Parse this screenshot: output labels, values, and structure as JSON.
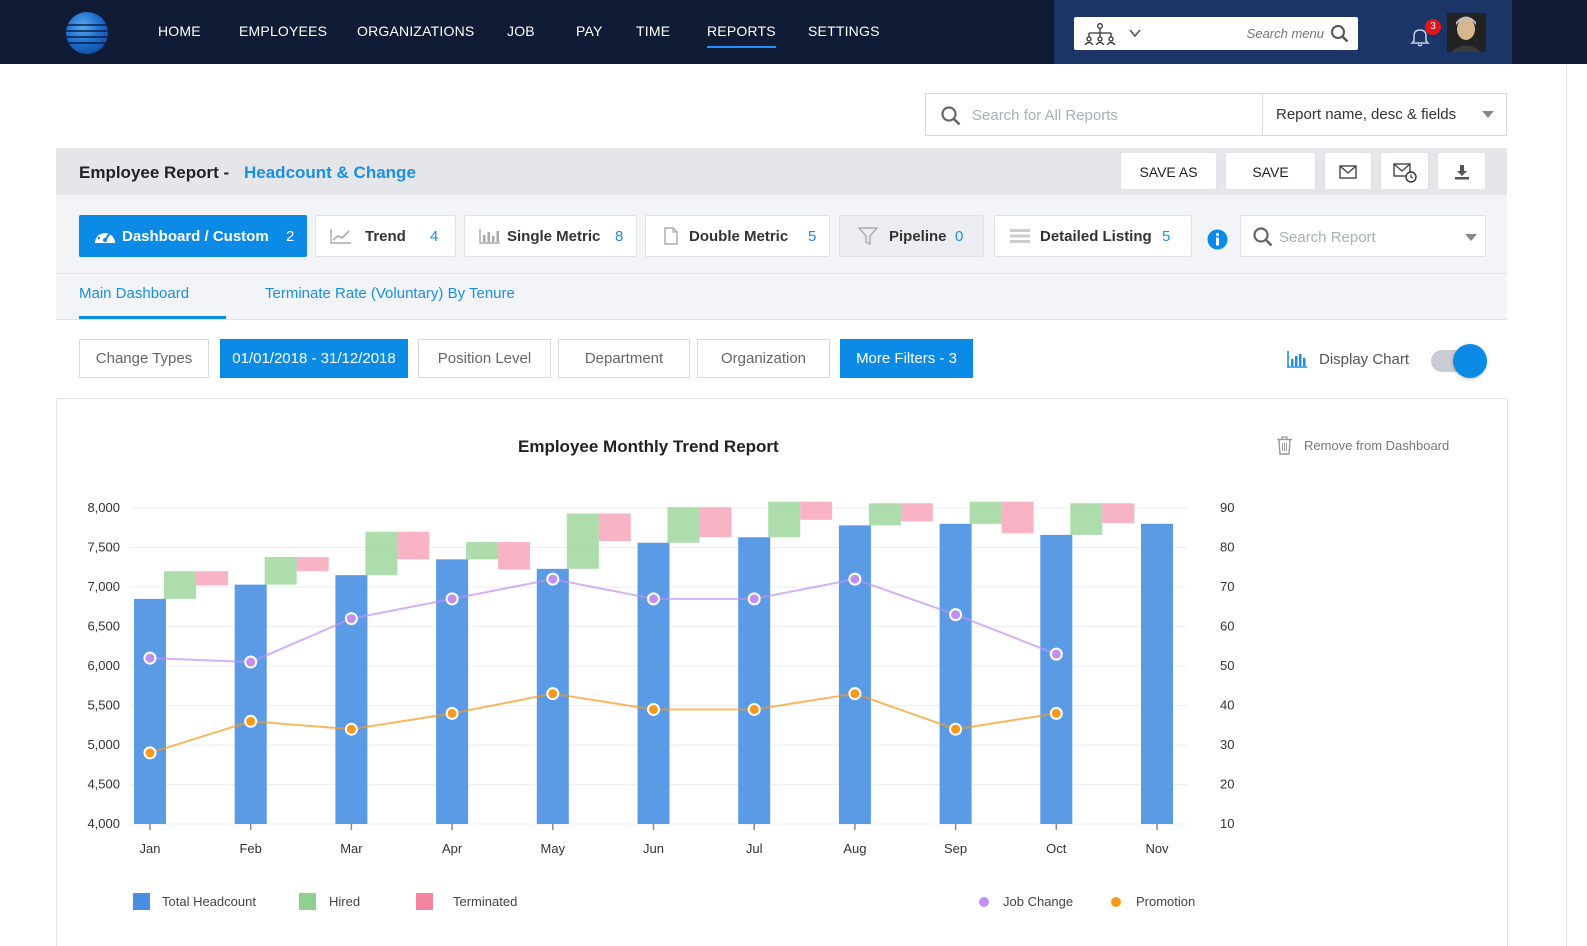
{
  "nav": {
    "items": [
      "HOME",
      "EMPLOYEES",
      "ORGANIZATIONS",
      "JOB",
      "PAY",
      "TIME",
      "REPORTS",
      "SETTINGS"
    ],
    "active": "REPORTS",
    "menu_search_placeholder": "Search menu",
    "notification_count": "3",
    "org_icon": "org-chart-icon"
  },
  "report_search": {
    "placeholder": "Search for All Reports",
    "scope": "Report name, desc & fields"
  },
  "report_header": {
    "title": "Employee Report -",
    "subtitle": "Headcount & Change",
    "save_as": "SAVE AS",
    "save": "SAVE"
  },
  "tabs": [
    {
      "label": "Dashboard / Custom",
      "count": "2",
      "icon": "dashboard-icon"
    },
    {
      "label": "Trend",
      "count": "4",
      "icon": "trend-icon"
    },
    {
      "label": "Single Metric",
      "count": "8",
      "icon": "bar-icon"
    },
    {
      "label": "Double Metric",
      "count": "5",
      "icon": "document-icon"
    },
    {
      "label": "Pipeline",
      "count": "0",
      "icon": "funnel-icon"
    },
    {
      "label": "Detailed Listing",
      "count": "5",
      "icon": "list-icon"
    }
  ],
  "search_report_placeholder": "Search Report",
  "subtabs": [
    "Main Dashboard",
    "Terminate Rate (Voluntary) By Tenure"
  ],
  "filters": {
    "change_types": "Change Types",
    "date_range": "01/01/2018 - 31/12/2018",
    "position_level": "Position Level",
    "department": "Department",
    "organization": "Organization",
    "more_filters": "More Filters - 3"
  },
  "display_chart": {
    "label": "Display Chart",
    "on": true
  },
  "remove_label": "Remove from Dashboard",
  "colors": {
    "accent": "#0b8be6",
    "headcount": "#5b9be5",
    "hired": "#9fd69f",
    "terminated": "#f7a7bb",
    "job_change": "#c290f5",
    "promotion": "#f59a1e"
  },
  "chart_data": {
    "type": "bar",
    "title": "Employee Monthly Trend Report",
    "categories": [
      "Jan",
      "Feb",
      "Mar",
      "Apr",
      "May",
      "Jun",
      "Jul",
      "Aug",
      "Sep",
      "Oct",
      "Nov"
    ],
    "y_left": {
      "ticks": [
        "4,000",
        "4,500",
        "5,000",
        "5,500",
        "6,000",
        "6,500",
        "7,000",
        "7,500",
        "8,000"
      ],
      "ylim": [
        4000,
        8000
      ]
    },
    "y_right": {
      "ticks": [
        "10",
        "20",
        "30",
        "40",
        "50",
        "60",
        "70",
        "80",
        "90"
      ],
      "ylim": [
        10,
        90
      ]
    },
    "series": [
      {
        "name": "Total Headcount",
        "type": "bar",
        "axis": "left",
        "values": [
          6850,
          7030,
          7150,
          7350,
          7230,
          7560,
          7630,
          7780,
          7800,
          7660,
          7800
        ]
      },
      {
        "name": "Hired",
        "type": "waterfall",
        "axis": "left",
        "values": [
          350,
          350,
          550,
          220,
          700,
          450,
          450,
          280,
          280,
          400
        ]
      },
      {
        "name": "Terminated",
        "type": "waterfall",
        "axis": "left",
        "values": [
          180,
          180,
          350,
          350,
          350,
          380,
          230,
          230,
          400,
          250
        ]
      },
      {
        "name": "Job Change",
        "type": "line",
        "axis": "right",
        "values": [
          52,
          51,
          62,
          67,
          72,
          67,
          67,
          72,
          63,
          53
        ]
      },
      {
        "name": "Promotion",
        "type": "line",
        "axis": "right",
        "values": [
          28,
          36,
          34,
          38,
          43,
          39,
          39,
          43,
          34,
          38
        ]
      }
    ],
    "legend_position": "bottom",
    "grid": true
  }
}
